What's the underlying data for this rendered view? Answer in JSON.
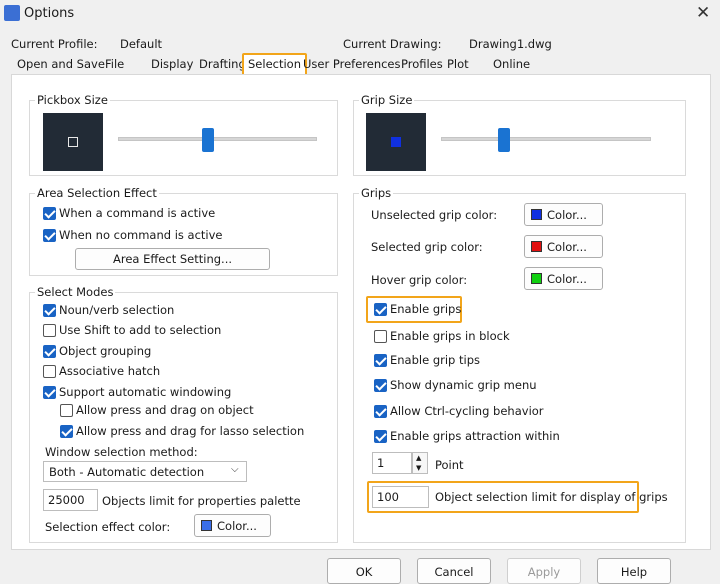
{
  "window": {
    "title": "Options"
  },
  "profile": {
    "label": "Current Profile:",
    "value": "Default"
  },
  "drawing": {
    "label": "Current Drawing:",
    "value": "Drawing1.dwg"
  },
  "tabs": [
    "Open and Save",
    "File",
    "Display",
    "Drafting",
    "Selection",
    "User Preferences",
    "Profiles",
    "Plot",
    "Online"
  ],
  "pickbox": {
    "title": "Pickbox Size",
    "level": 0.45
  },
  "area_selection": {
    "title": "Area Selection Effect",
    "when_active": "When a command is active",
    "when_none": "When no command is active",
    "setting_button": "Area Effect Setting..."
  },
  "select_modes": {
    "title": "Select Modes",
    "items": [
      {
        "label": "Noun/verb selection",
        "checked": true
      },
      {
        "label": "Use Shift to add to selection",
        "checked": false
      },
      {
        "label": "Object grouping",
        "checked": true
      },
      {
        "label": "Associative hatch",
        "checked": false
      },
      {
        "label": "Support automatic windowing",
        "checked": true
      },
      {
        "label": "Allow press and drag on object",
        "checked": false
      },
      {
        "label": "Allow press and drag for lasso selection",
        "checked": true
      }
    ],
    "window_method_label": "Window selection method:",
    "window_method_value": "Both - Automatic detection",
    "objects_limit_value": "25000",
    "objects_limit_label": "Objects limit for properties palette",
    "effect_color_label": "Selection effect color:",
    "effect_color_button": "Color..."
  },
  "grip_size": {
    "title": "Grip Size",
    "level": 0.3
  },
  "grips": {
    "title": "Grips",
    "unselected_label": "Unselected grip color:",
    "selected_label": "Selected grip color:",
    "hover_label": "Hover grip color:",
    "color_button": "Color...",
    "options": [
      {
        "label": "Enable grips",
        "checked": true
      },
      {
        "label": "Enable grips in block",
        "checked": false
      },
      {
        "label": "Enable grip tips",
        "checked": true
      },
      {
        "label": "Show dynamic grip menu",
        "checked": true
      },
      {
        "label": "Allow Ctrl-cycling behavior",
        "checked": true
      },
      {
        "label": "Enable grips attraction within",
        "checked": true
      }
    ],
    "point_value": "1",
    "point_label": "Point",
    "limit_value": "100",
    "limit_label": "Object selection limit for display of grips"
  },
  "buttons": {
    "ok": "OK",
    "cancel": "Cancel",
    "apply": "Apply",
    "help": "Help"
  },
  "colors": {
    "unselected": "#1030e0",
    "selected": "#e01010",
    "hover": "#10d010",
    "selection_effect": "#3a6ee8",
    "highlight": "#f2a51a"
  }
}
